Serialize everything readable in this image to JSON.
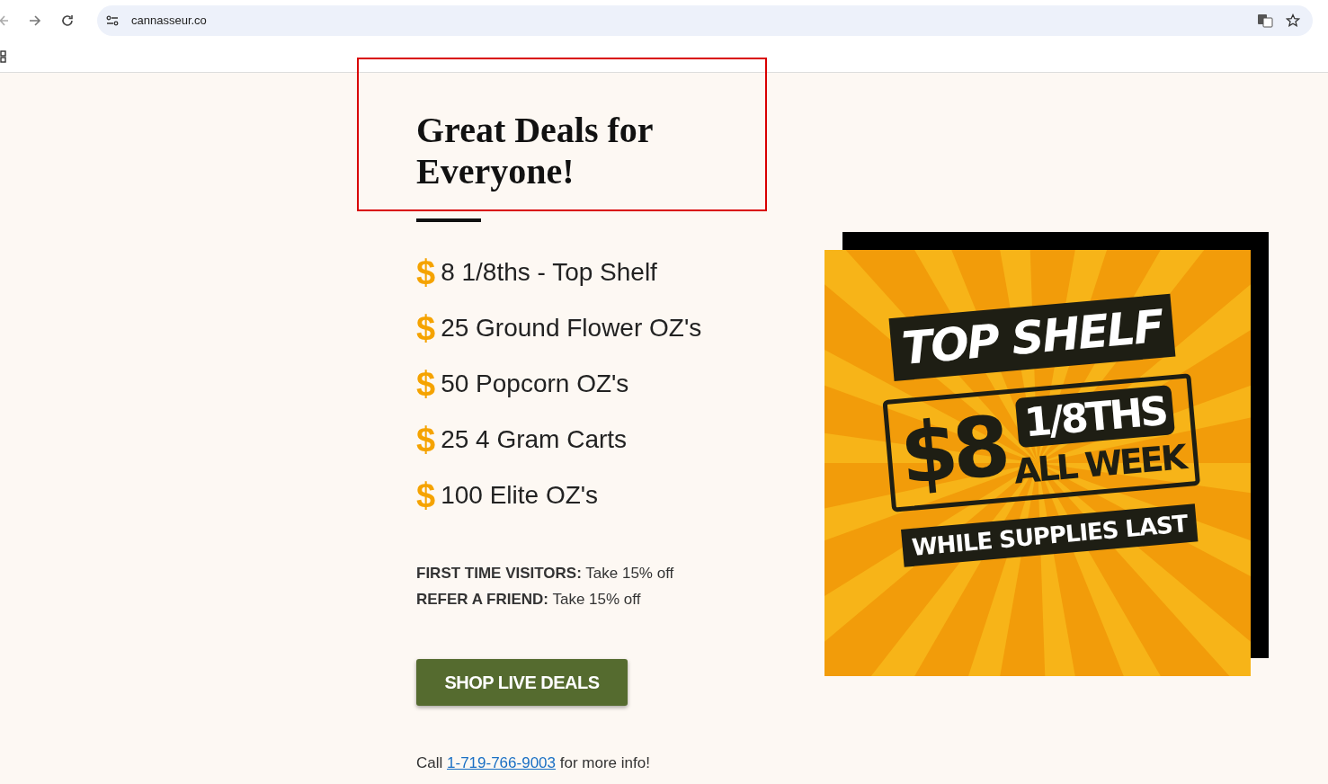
{
  "browser": {
    "url": "cannasseur.co"
  },
  "heading": "Great Deals for Everyone!",
  "deals": [
    {
      "symbol": "$",
      "text": "8 1/8ths - Top Shelf"
    },
    {
      "symbol": "$",
      "text": "25 Ground Flower OZ's"
    },
    {
      "symbol": "$",
      "text": "50 Popcorn OZ's"
    },
    {
      "symbol": "$",
      "text": "25 4 Gram Carts"
    },
    {
      "symbol": "$",
      "text": "100 Elite OZ's"
    }
  ],
  "promos": [
    {
      "label": "FIRST TIME VISITORS:",
      "text": "Take 15% off"
    },
    {
      "label": "REFER A FRIEND:",
      "text": "Take 15% off"
    }
  ],
  "button": "SHOP LIVE DEALS",
  "contact": {
    "before": "Call",
    "link": "1-719-766-9003",
    "after": "for more info!"
  },
  "ad": {
    "headline": "TOP SHELF",
    "price": "$8",
    "unit": "1/8THS",
    "period": "ALL WEEK",
    "footer": "WHILE SUPPLIES LAST"
  }
}
